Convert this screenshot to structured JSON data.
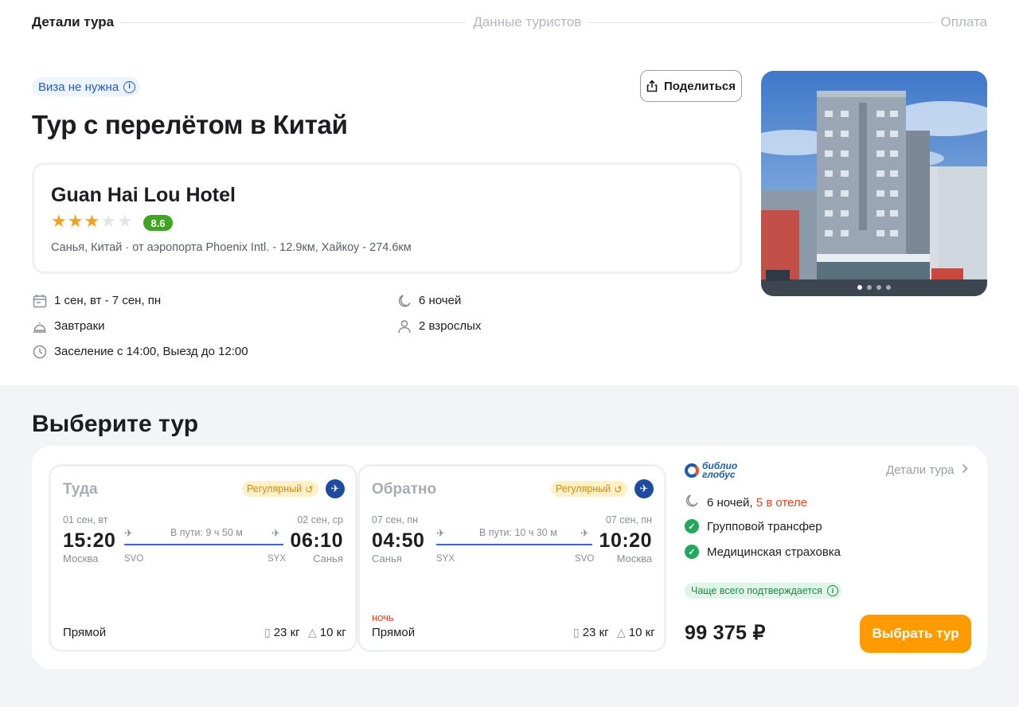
{
  "steps": {
    "details": "Детали тура",
    "tourists": "Данные туристов",
    "payment": "Оплата"
  },
  "visa": {
    "label": "Виза не нужна"
  },
  "share": {
    "label": "Поделиться"
  },
  "tour": {
    "title": "Тур с перелётом в Китай"
  },
  "hotel": {
    "name": "Guan Hai Lou Hotel",
    "stars": 3,
    "max_stars": 5,
    "rating": "8.6",
    "location": "Санья, Китай · от аэропорта Phoenix Intl. - 12.9км, Хайкоу - 274.6км"
  },
  "facts": {
    "dates": "1 сен, вт - 7 сен, пн",
    "nights": "6 ночей",
    "meal": "Завтраки",
    "guests": "2 взрослых",
    "checkin": "Заселение с 14:00, Выезд до 12:00"
  },
  "gallery": {
    "slides": 4,
    "current": 1
  },
  "section": {
    "title": "Выберите тур"
  },
  "outbound": {
    "direction": "Туда",
    "badge": "Регулярный",
    "dep_date": "01 сен, вт",
    "arr_date": "02 сен, ср",
    "dep_time": "15:20",
    "arr_time": "06:10",
    "dep_city": "Москва",
    "arr_city": "Санья",
    "dep_code": "SVO",
    "arr_code": "SYX",
    "duration": "В пути: 9 ч 50 м",
    "night": "",
    "type": "Прямой",
    "baggage": "23 кг",
    "hand": "10 кг"
  },
  "inbound": {
    "direction": "Обратно",
    "badge": "Регулярный",
    "dep_date": "07 сен, пн",
    "arr_date": "07 сен, пн",
    "dep_time": "04:50",
    "arr_time": "10:20",
    "dep_city": "Санья",
    "arr_city": "Москва",
    "dep_code": "SYX",
    "arr_code": "SVO",
    "duration": "В пути: 10 ч 30 м",
    "night": "ночь",
    "type": "Прямой",
    "baggage": "23 кг",
    "hand": "10 кг"
  },
  "operator": {
    "logo_line1": "библио",
    "logo_line2": "глобус",
    "details_link": "Детали тура",
    "nights": "6 ночей,",
    "nights_hotel": "5 в отеле",
    "transfer": "Групповой трансфер",
    "insurance": "Медицинская страховка",
    "confirm": "Чаще всего подтверждается",
    "price": "99 375 ₽",
    "cta": "Выбрать тур"
  },
  "colors": {
    "accent": "#ff9a00",
    "link": "#1d5ad6",
    "success": "#23a85b",
    "warning": "#e5411c"
  }
}
